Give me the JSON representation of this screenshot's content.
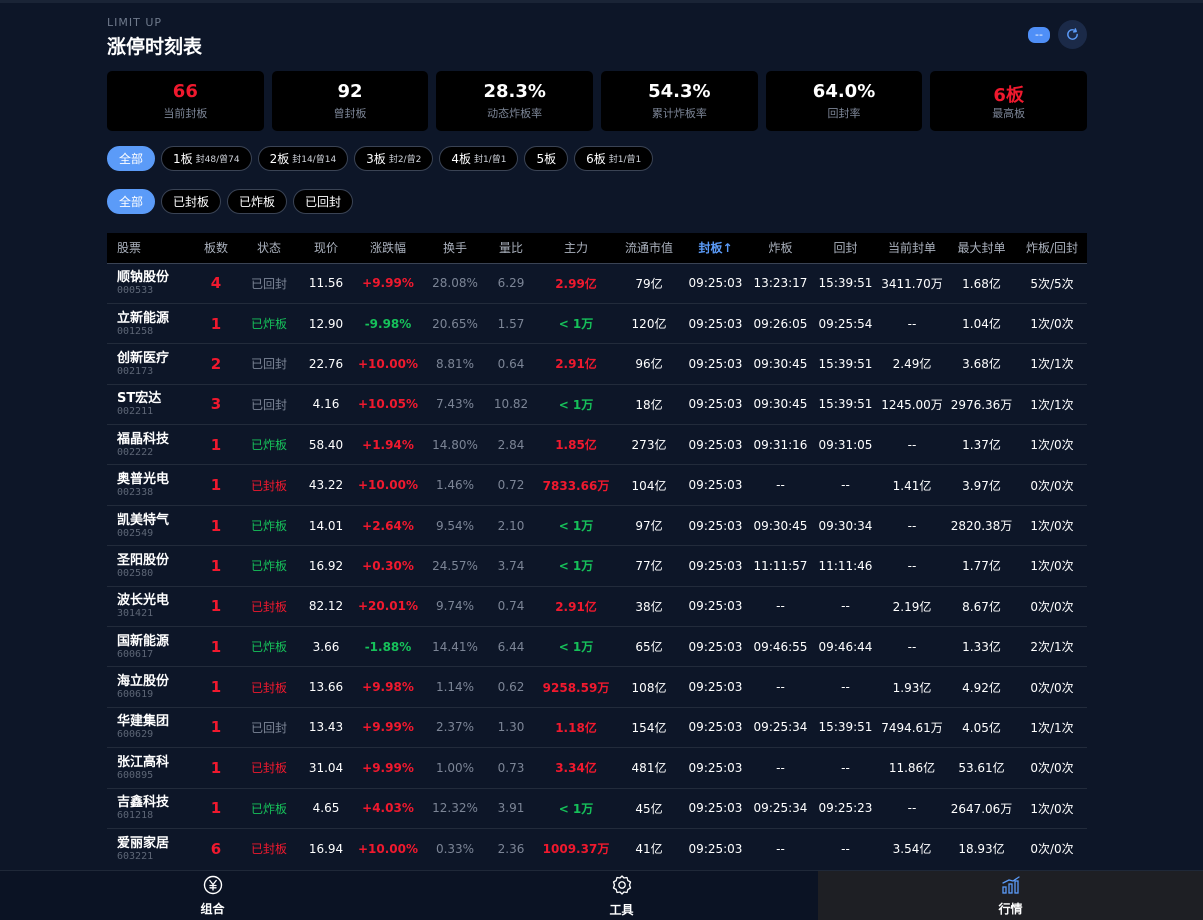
{
  "header": {
    "sup": "LIMIT UP",
    "title": "涨停时刻表",
    "badge": "--"
  },
  "stats": [
    {
      "value": "66",
      "label": "当前封板",
      "red": true
    },
    {
      "value": "92",
      "label": "曾封板",
      "red": false
    },
    {
      "value": "28.3%",
      "label": "动态炸板率",
      "red": false
    },
    {
      "value": "54.3%",
      "label": "累计炸板率",
      "red": false
    },
    {
      "value": "64.0%",
      "label": "回封率",
      "red": false
    },
    {
      "value": "6板",
      "label": "最高板",
      "red": true
    }
  ],
  "board_filters": [
    {
      "label": "全部",
      "sub": "",
      "active": true
    },
    {
      "label": "1板",
      "sub": "封48/曾74",
      "active": false
    },
    {
      "label": "2板",
      "sub": "封14/曾14",
      "active": false
    },
    {
      "label": "3板",
      "sub": "封2/曾2",
      "active": false
    },
    {
      "label": "4板",
      "sub": "封1/曾1",
      "active": false
    },
    {
      "label": "5板",
      "sub": "",
      "active": false
    },
    {
      "label": "6板",
      "sub": "封1/曾1",
      "active": false
    }
  ],
  "status_filters": [
    {
      "label": "全部",
      "active": true
    },
    {
      "label": "已封板",
      "active": false
    },
    {
      "label": "已炸板",
      "active": false
    },
    {
      "label": "已回封",
      "active": false
    }
  ],
  "columns": [
    "股票",
    "板数",
    "状态",
    "现价",
    "涨跌幅",
    "换手",
    "量比",
    "主力",
    "流通市值",
    "封板↑",
    "炸板",
    "回封",
    "当前封单",
    "最大封单",
    "炸板/回封"
  ],
  "sorted_column": 9,
  "rows": [
    {
      "name": "顺钠股份",
      "code": "000533",
      "boards": "4",
      "status": "已回封",
      "price": "11.56",
      "chg": "+9.99%",
      "turnover": "28.08%",
      "vr": "6.29",
      "main": "2.99亿",
      "mcap": "79亿",
      "seal": "09:25:03",
      "burst": "13:23:17",
      "reseal": "15:39:51",
      "cur": "3411.70万",
      "max": "1.68亿",
      "br": "5次/5次"
    },
    {
      "name": "立新能源",
      "code": "001258",
      "boards": "1",
      "status": "已炸板",
      "price": "12.90",
      "chg": "-9.98%",
      "turnover": "20.65%",
      "vr": "1.57",
      "main": "< 1万",
      "mcap": "120亿",
      "seal": "09:25:03",
      "burst": "09:26:05",
      "reseal": "09:25:54",
      "cur": "--",
      "max": "1.04亿",
      "br": "1次/0次"
    },
    {
      "name": "创新医疗",
      "code": "002173",
      "boards": "2",
      "status": "已回封",
      "price": "22.76",
      "chg": "+10.00%",
      "turnover": "8.81%",
      "vr": "0.64",
      "main": "2.91亿",
      "mcap": "96亿",
      "seal": "09:25:03",
      "burst": "09:30:45",
      "reseal": "15:39:51",
      "cur": "2.49亿",
      "max": "3.68亿",
      "br": "1次/1次"
    },
    {
      "name": "ST宏达",
      "code": "002211",
      "boards": "3",
      "status": "已回封",
      "price": "4.16",
      "chg": "+10.05%",
      "turnover": "7.43%",
      "vr": "10.82",
      "main": "< 1万",
      "mcap": "18亿",
      "seal": "09:25:03",
      "burst": "09:30:45",
      "reseal": "15:39:51",
      "cur": "1245.00万",
      "max": "2976.36万",
      "br": "1次/1次"
    },
    {
      "name": "福晶科技",
      "code": "002222",
      "boards": "1",
      "status": "已炸板",
      "price": "58.40",
      "chg": "+1.94%",
      "turnover": "14.80%",
      "vr": "2.84",
      "main": "1.85亿",
      "mcap": "273亿",
      "seal": "09:25:03",
      "burst": "09:31:16",
      "reseal": "09:31:05",
      "cur": "--",
      "max": "1.37亿",
      "br": "1次/0次"
    },
    {
      "name": "奥普光电",
      "code": "002338",
      "boards": "1",
      "status": "已封板",
      "price": "43.22",
      "chg": "+10.00%",
      "turnover": "1.46%",
      "vr": "0.72",
      "main": "7833.66万",
      "mcap": "104亿",
      "seal": "09:25:03",
      "burst": "--",
      "reseal": "--",
      "cur": "1.41亿",
      "max": "3.97亿",
      "br": "0次/0次"
    },
    {
      "name": "凯美特气",
      "code": "002549",
      "boards": "1",
      "status": "已炸板",
      "price": "14.01",
      "chg": "+2.64%",
      "turnover": "9.54%",
      "vr": "2.10",
      "main": "< 1万",
      "mcap": "97亿",
      "seal": "09:25:03",
      "burst": "09:30:45",
      "reseal": "09:30:34",
      "cur": "--",
      "max": "2820.38万",
      "br": "1次/0次"
    },
    {
      "name": "圣阳股份",
      "code": "002580",
      "boards": "1",
      "status": "已炸板",
      "price": "16.92",
      "chg": "+0.30%",
      "turnover": "24.57%",
      "vr": "3.74",
      "main": "< 1万",
      "mcap": "77亿",
      "seal": "09:25:03",
      "burst": "11:11:57",
      "reseal": "11:11:46",
      "cur": "--",
      "max": "1.77亿",
      "br": "1次/0次"
    },
    {
      "name": "波长光电",
      "code": "301421",
      "boards": "1",
      "status": "已封板",
      "price": "82.12",
      "chg": "+20.01%",
      "turnover": "9.74%",
      "vr": "0.74",
      "main": "2.91亿",
      "mcap": "38亿",
      "seal": "09:25:03",
      "burst": "--",
      "reseal": "--",
      "cur": "2.19亿",
      "max": "8.67亿",
      "br": "0次/0次"
    },
    {
      "name": "国新能源",
      "code": "600617",
      "boards": "1",
      "status": "已炸板",
      "price": "3.66",
      "chg": "-1.88%",
      "turnover": "14.41%",
      "vr": "6.44",
      "main": "< 1万",
      "mcap": "65亿",
      "seal": "09:25:03",
      "burst": "09:46:55",
      "reseal": "09:46:44",
      "cur": "--",
      "max": "1.33亿",
      "br": "2次/1次"
    },
    {
      "name": "海立股份",
      "code": "600619",
      "boards": "1",
      "status": "已封板",
      "price": "13.66",
      "chg": "+9.98%",
      "turnover": "1.14%",
      "vr": "0.62",
      "main": "9258.59万",
      "mcap": "108亿",
      "seal": "09:25:03",
      "burst": "--",
      "reseal": "--",
      "cur": "1.93亿",
      "max": "4.92亿",
      "br": "0次/0次"
    },
    {
      "name": "华建集团",
      "code": "600629",
      "boards": "1",
      "status": "已回封",
      "price": "13.43",
      "chg": "+9.99%",
      "turnover": "2.37%",
      "vr": "1.30",
      "main": "1.18亿",
      "mcap": "154亿",
      "seal": "09:25:03",
      "burst": "09:25:34",
      "reseal": "15:39:51",
      "cur": "7494.61万",
      "max": "4.05亿",
      "br": "1次/1次"
    },
    {
      "name": "张江高科",
      "code": "600895",
      "boards": "1",
      "status": "已封板",
      "price": "31.04",
      "chg": "+9.99%",
      "turnover": "1.00%",
      "vr": "0.73",
      "main": "3.34亿",
      "mcap": "481亿",
      "seal": "09:25:03",
      "burst": "--",
      "reseal": "--",
      "cur": "11.86亿",
      "max": "53.61亿",
      "br": "0次/0次"
    },
    {
      "name": "吉鑫科技",
      "code": "601218",
      "boards": "1",
      "status": "已炸板",
      "price": "4.65",
      "chg": "+4.03%",
      "turnover": "12.32%",
      "vr": "3.91",
      "main": "< 1万",
      "mcap": "45亿",
      "seal": "09:25:03",
      "burst": "09:25:34",
      "reseal": "09:25:23",
      "cur": "--",
      "max": "2647.06万",
      "br": "1次/0次"
    },
    {
      "name": "爱丽家居",
      "code": "603221",
      "boards": "6",
      "status": "已封板",
      "price": "16.94",
      "chg": "+10.00%",
      "turnover": "0.33%",
      "vr": "2.36",
      "main": "1009.37万",
      "mcap": "41亿",
      "seal": "09:25:03",
      "burst": "--",
      "reseal": "--",
      "cur": "3.54亿",
      "max": "18.93亿",
      "br": "0次/0次"
    }
  ],
  "nav": [
    {
      "label": "组合",
      "icon": "yuan-coin-icon",
      "active": false
    },
    {
      "label": "工具",
      "icon": "gear-icon",
      "active": false
    },
    {
      "label": "行情",
      "icon": "bar-chart-icon",
      "active": true
    }
  ],
  "colors": {
    "red": "#f0192e",
    "green": "#16c15a",
    "accent": "#5b9bf8"
  }
}
